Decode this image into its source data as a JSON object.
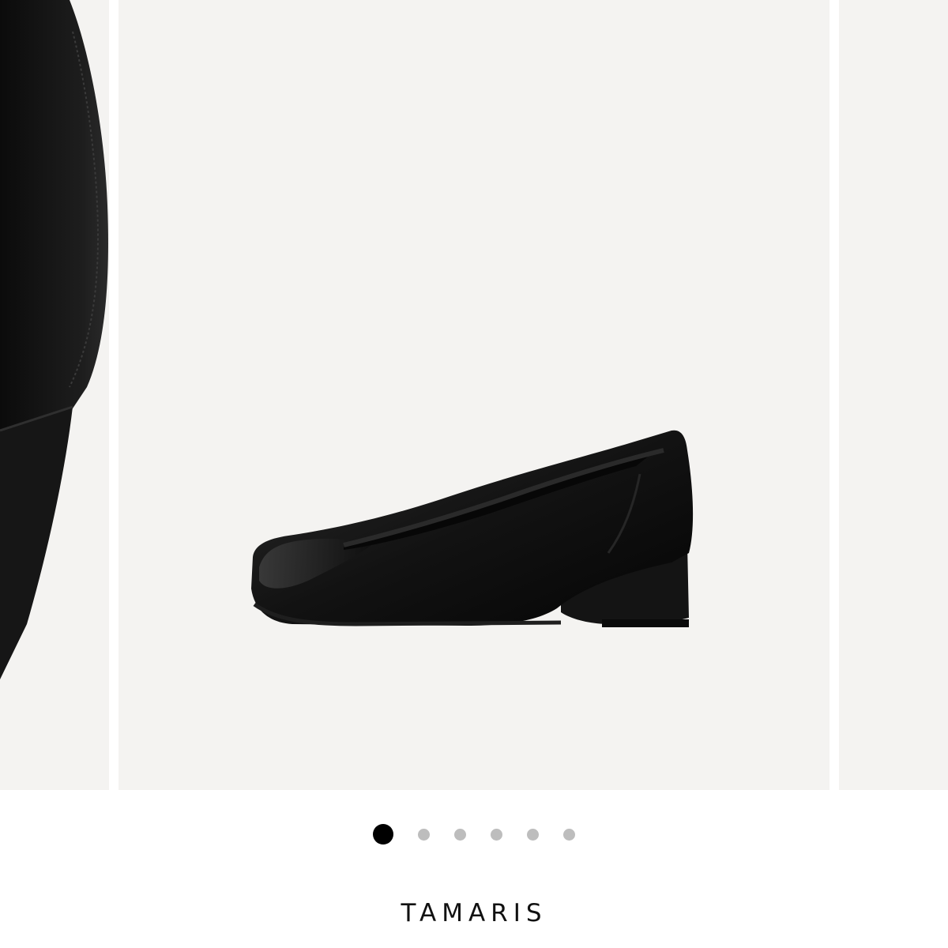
{
  "gallery": {
    "slides": [
      {
        "label": "previous-image",
        "icon": "shoe-heel-closeup-image"
      },
      {
        "label": "current-image",
        "icon": "black-wedge-pump-image"
      },
      {
        "label": "next-image",
        "icon": "blank-image"
      }
    ],
    "zoom_icon": "magnifier-icon",
    "dots": {
      "count": 6,
      "active_index": 0
    },
    "colors": {
      "slide_background": "#f4f3f1",
      "active_dot": "#000000",
      "inactive_dot": "#bdbdbd"
    }
  },
  "product": {
    "brand": "TAMARIS"
  }
}
